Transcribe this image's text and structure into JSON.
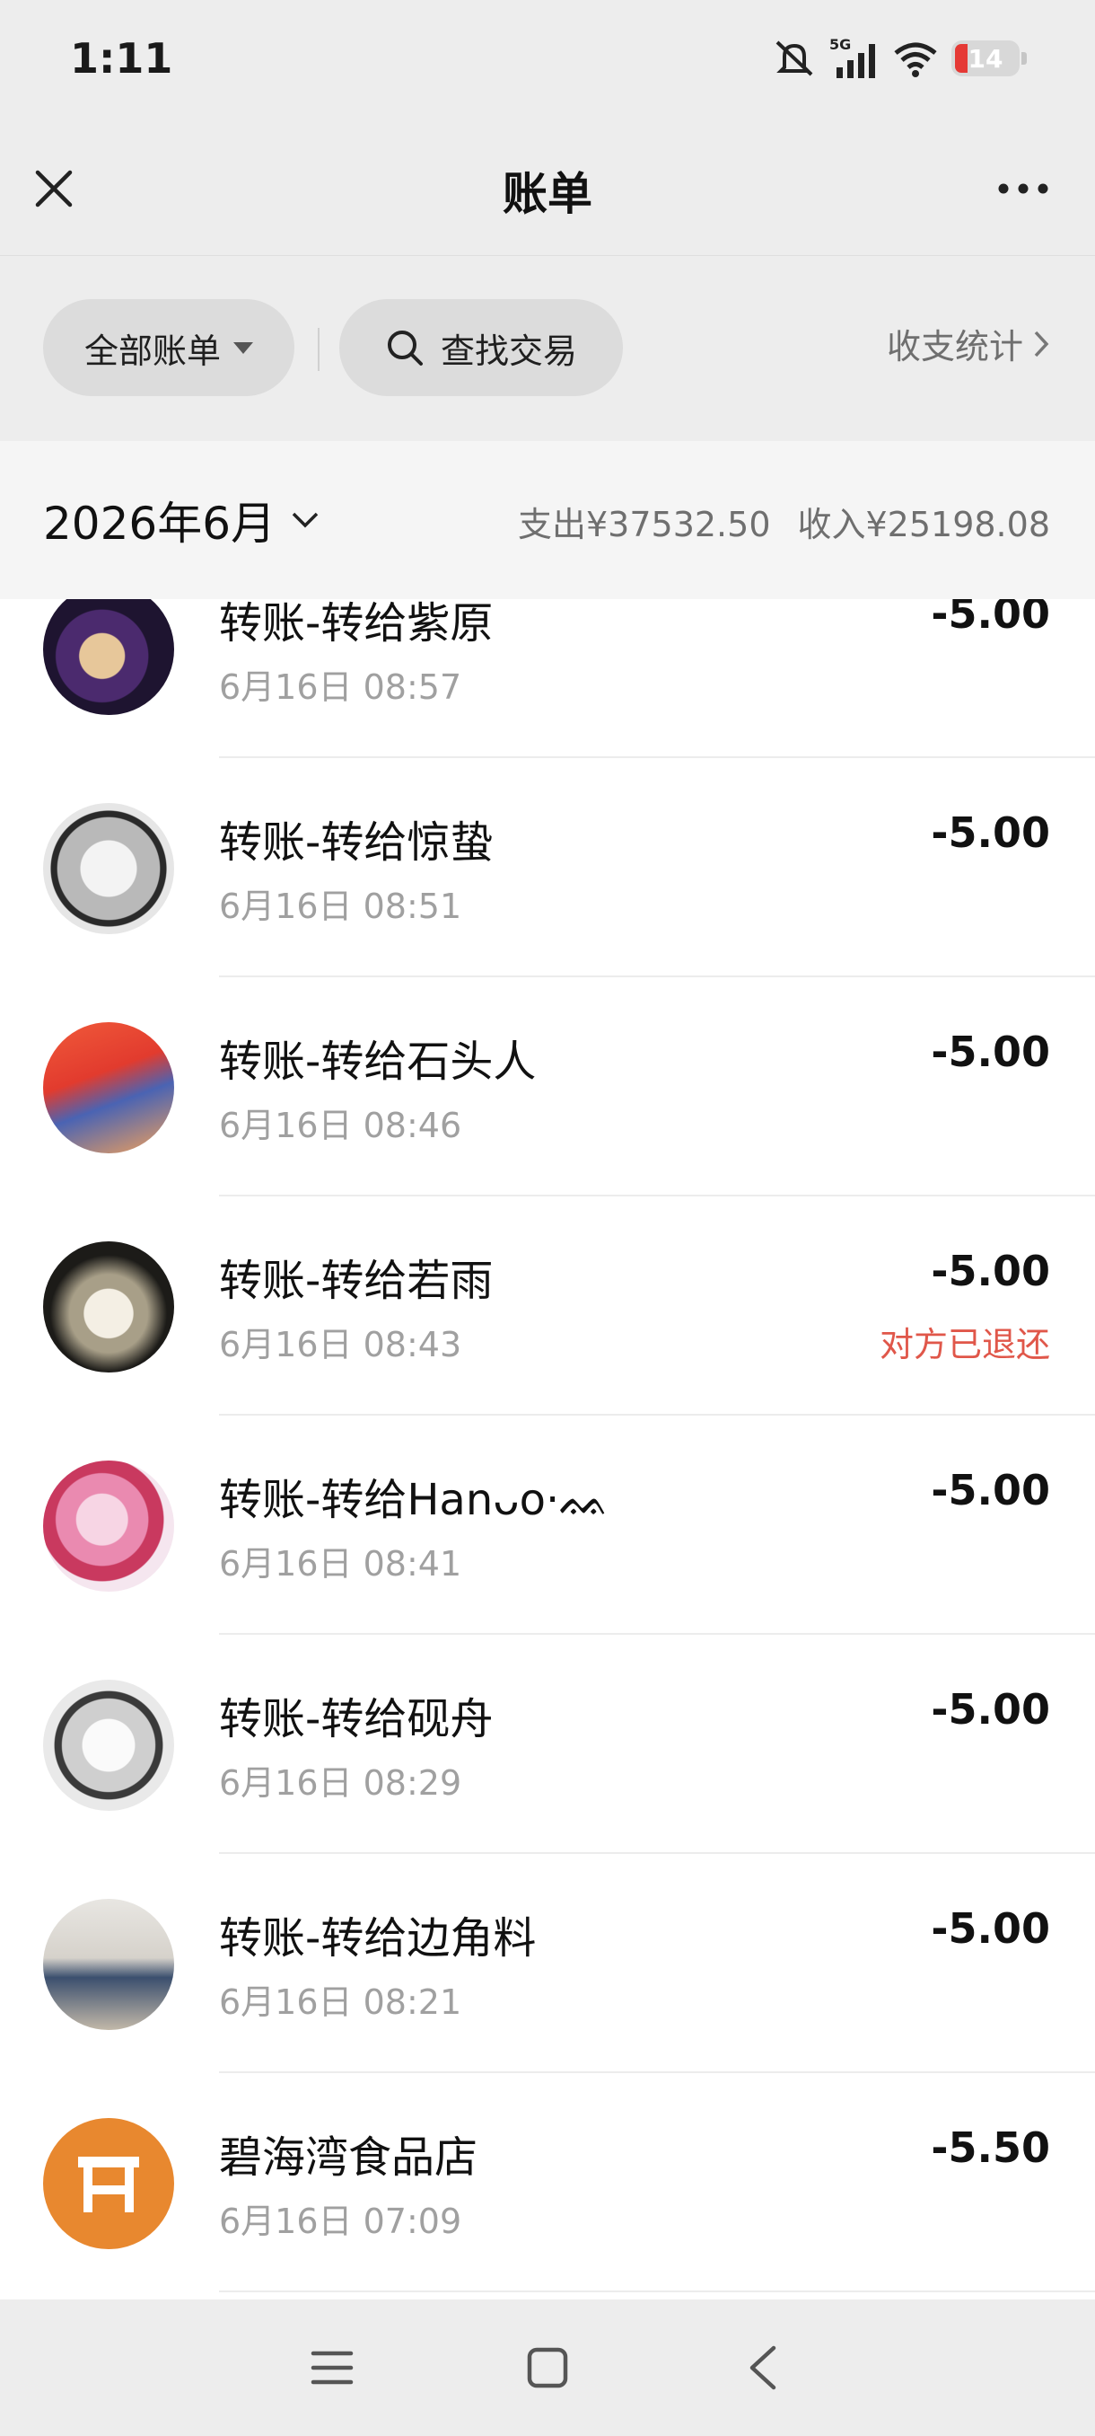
{
  "status_bar": {
    "time": "1:11",
    "network": "5G",
    "battery": "14",
    "icons": [
      "mute-icon",
      "signal-icon",
      "wifi-icon",
      "battery-icon"
    ]
  },
  "header": {
    "title": "账单",
    "close_icon": "close-icon",
    "more_icon": "more-icon"
  },
  "filters": {
    "all_bills_label": "全部账单",
    "search_label": "查找交易",
    "stats_label": "收支统计"
  },
  "month": {
    "label": "2026年6月",
    "expense": "支出¥37532.50",
    "income": "收入¥25198.08"
  },
  "transactions": [
    {
      "name": "转账-转给紫原",
      "time": "6月16日 08:57",
      "amount": "-5.00",
      "status": ""
    },
    {
      "name": "转账-转给惊蛰",
      "time": "6月16日 08:51",
      "amount": "-5.00",
      "status": ""
    },
    {
      "name": "转账-转给石头人",
      "time": "6月16日 08:46",
      "amount": "-5.00",
      "status": ""
    },
    {
      "name": "转账-转给若雨",
      "time": "6月16日 08:43",
      "amount": "-5.00",
      "status": "对方已退还"
    },
    {
      "name": "转账-转给Hanᴗo·ᨐ",
      "time": "6月16日 08:41",
      "amount": "-5.00",
      "status": ""
    },
    {
      "name": "转账-转给砚舟",
      "time": "6月16日 08:29",
      "amount": "-5.00",
      "status": ""
    },
    {
      "name": "转账-转给边角料",
      "time": "6月16日 08:21",
      "amount": "-5.00",
      "status": ""
    },
    {
      "name": "碧海湾食品店",
      "time": "6月16日 07:09",
      "amount": "-5.50",
      "status": ""
    }
  ],
  "colors": {
    "refund_status": "#e0574a",
    "merchant_avatar": "#e8882f",
    "background_gray": "#ededed"
  }
}
